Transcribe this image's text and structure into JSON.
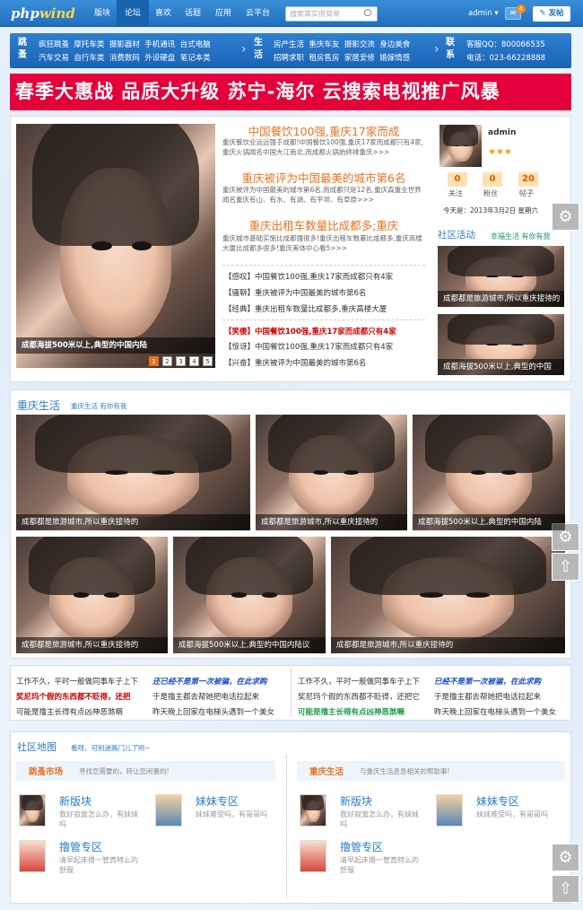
{
  "header": {
    "logo_a": "php",
    "logo_b": "wind",
    "nav": [
      "版块",
      "论坛",
      "喜欢",
      "话题",
      "应用",
      "云平台"
    ],
    "search_placeholder": "搜索其实很简单",
    "user": "admin",
    "msg_count": "4",
    "post_button": "发帖"
  },
  "categories": {
    "g1": "跳蚤",
    "r1": [
      "疯狂跳蚤",
      "摩托车类",
      "摄影器材",
      "手机通讯",
      "台式电脑"
    ],
    "r2": [
      "汽车交易",
      "自行车类",
      "消费数码",
      "外设硬盘",
      "笔记本类"
    ],
    "g2": "生活",
    "s1": [
      "房产生活",
      "重庆车友",
      "摄影交流",
      "身边美食"
    ],
    "s2": [
      "招聘求职",
      "租房售房",
      "家居爱修",
      "婚嫁情感"
    ],
    "g3": "联系",
    "c1": "客服QQ：800066535",
    "c2": "电话：023-66228888"
  },
  "banner": "春季大惠战  品质大升级  苏宁-海尔 云搜索电视推广风暴",
  "slider": {
    "caption": "成都海拔500米以上,典型的中国内陆",
    "pages": [
      "1",
      "2",
      "3",
      "4",
      "5"
    ]
  },
  "headlines": [
    {
      "title": "中国餐饮100强,重庆17家而成",
      "summary": "重庆餐饮业远远强于成都!中国餐饮100强,重庆17家而成都只有4家,重庆火锅闻名中国大江南北,而成都火锅始终排重庆>>>"
    },
    {
      "title": "重庆被评为中国最美的城市第6名",
      "summary": "重庆被评为中国最美的城市第6名,而成都只是12名,重庆森重全世界闻名重庆有山、有水、有湖、有平坝、有草原>>>"
    },
    {
      "title": "重庆出租车数量比成都多;重庆",
      "summary": "重庆城市基础实施比成都强很多!重庆出租车数量比成都多,重庆高楼大厦比成都多很多!重庆美体中心看5>>>"
    }
  ],
  "news": [
    {
      "text": "【感叹】中国餐饮100强,重庆17家而成都只有4家",
      "style": ""
    },
    {
      "text": "【骚聊】重庆被评为中国最美的城市第6名",
      "style": ""
    },
    {
      "text": "【经典】重庆出租车数量比成都多,重庆高楼大厦",
      "style": ""
    },
    {
      "text": "【笑傻】中国餐饮100强,重庆17家而成都只有4家",
      "style": "red"
    },
    {
      "text": "【惊讶】中国餐饮100强,重庆17家而成都只有4家",
      "style": ""
    },
    {
      "text": "【兴奋】重庆被评为中国最美的城市第6名",
      "style": ""
    }
  ],
  "user": {
    "name": "admin",
    "stars": "★★★",
    "stats": [
      {
        "value": "0",
        "label": "关注"
      },
      {
        "value": "0",
        "label": "粉丝"
      },
      {
        "value": "20",
        "label": "帖子"
      }
    ],
    "date": "今天是：2013年3月2日 星期六"
  },
  "community": {
    "title": "社区活动",
    "subtitle": "幸福生活 有你有我",
    "items": [
      "成都都是旅游城市,所以重庆接待的",
      "成都海拔500米以上,典型的中国"
    ]
  },
  "feature": {
    "title": "重庆生活",
    "subtitle": "重庆生活 有你有我",
    "row1": [
      "成都都是旅游城市,所以重庆接待的",
      "成都都是旅游城市,所以重庆接待的",
      "成都海拔500米以上,典型的中国内陆"
    ],
    "row2": [
      "成都都是旅游城市,所以重庆接待的",
      "成都海拔500米以上,典型的中国内陆议",
      "成都都是旅游城市,所以重庆接待的"
    ]
  },
  "texts": {
    "left": [
      [
        "工作不久，平时一般做同事车子上下",
        "班"
      ],
      [
        "奖尼玛个假的东西都不眨得，还把",
        "于是撸主都去帮她把电话拉起来"
      ],
      [
        "可能是撸主长得有点凶神恶煞噘",
        "昨天晚上回家在电梯头遇到一个美女"
      ]
    ],
    "left_hl": "还已经不是第一次被骗，在此求购",
    "right": [
      "工作不久，平时一般做同事车子上下",
      "奖尼玛个假的东西都不眨得，还把它",
      "于是撸主都去帮她把电话拉起来",
      "昨天晚上回家在电梯头遇到一个美女"
    ],
    "right_hl1": "已经不是第一次被骗，在此求购",
    "right_hl2": "可能是撸主长得有点凶神恶煞噘"
  },
  "map": {
    "title": "社区地图",
    "subtitle": "看呀，可别迷路门儿了哟~",
    "left": {
      "bar": "跳蚤市场",
      "bar_sub": "寻找您需要的，转让您闲置的!"
    },
    "right": {
      "bar": "重庆生活",
      "bar_sub": "与重庆生活息息相关的帮助事!"
    },
    "forums": [
      {
        "name": "新版块",
        "desc": "我好寂寞怎么办，有妹妹吗"
      },
      {
        "name": "妹妹专区",
        "desc": "妹妹难受吗，有哥哥吗"
      },
      {
        "name": "撸管专区",
        "desc": "清早起床撸一管真特么的舒服"
      }
    ]
  },
  "side_icons": [
    "gear-icon",
    "arrow-up-icon"
  ]
}
